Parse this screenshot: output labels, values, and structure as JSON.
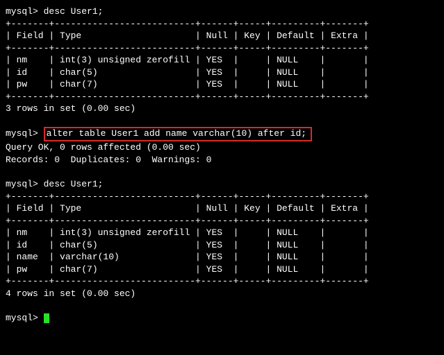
{
  "prompt": "mysql>",
  "commands": {
    "desc1": "desc User1;",
    "alter": "alter table User1 add name varchar(10) after id;",
    "desc2": "desc User1;"
  },
  "table1": {
    "sep_top": "+-------+--------------------------+------+-----+---------+-------+",
    "header": "| Field | Type                     | Null | Key | Default | Extra |",
    "sep_mid": "+-------+--------------------------+------+-----+---------+-------+",
    "rows": [
      "| nm    | int(3) unsigned zerofill | YES  |     | NULL    |       |",
      "| id    | char(5)                  | YES  |     | NULL    |       |",
      "| pw    | char(7)                  | YES  |     | NULL    |       |"
    ],
    "sep_bot": "+-------+--------------------------+------+-----+---------+-------+",
    "footer": "3 rows in set (0.00 sec)"
  },
  "alter_result": {
    "line1": "Query OK, 0 rows affected (0.00 sec)",
    "line2": "Records: 0  Duplicates: 0  Warnings: 0"
  },
  "table2": {
    "sep_top": "+-------+--------------------------+------+-----+---------+-------+",
    "header": "| Field | Type                     | Null | Key | Default | Extra |",
    "sep_mid": "+-------+--------------------------+------+-----+---------+-------+",
    "rows": [
      "| nm    | int(3) unsigned zerofill | YES  |     | NULL    |       |",
      "| id    | char(5)                  | YES  |     | NULL    |       |",
      "| name  | varchar(10)              | YES  |     | NULL    |       |",
      "| pw    | char(7)                  | YES  |     | NULL    |       |"
    ],
    "sep_bot": "+-------+--------------------------+------+-----+---------+-------+",
    "footer": "4 rows in set (0.00 sec)"
  }
}
